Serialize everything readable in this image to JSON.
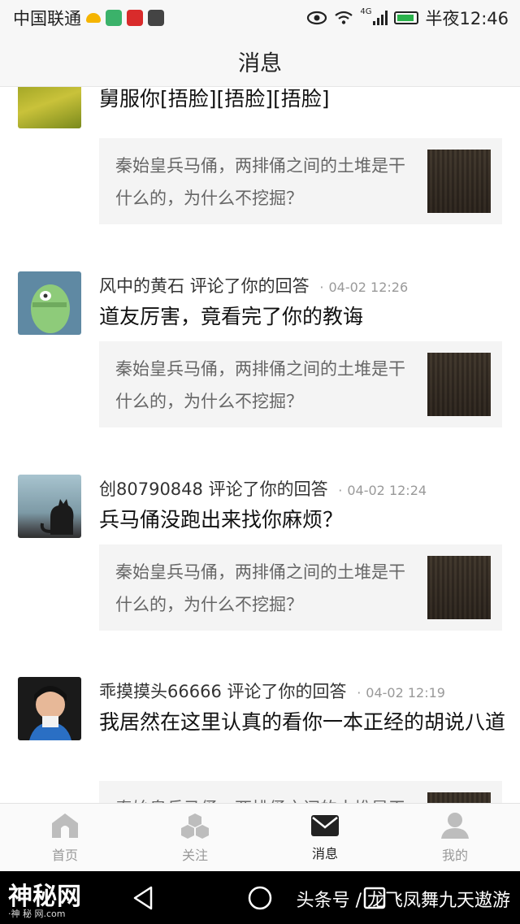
{
  "status_bar": {
    "carrier": "中国联通",
    "network": "4G",
    "time": "半夜12:46"
  },
  "header": {
    "title": "消息"
  },
  "feed": {
    "items": [
      {
        "user": "",
        "action": "",
        "time": "",
        "comment": "舅服你[捂脸][捂脸][捂脸]",
        "question": "秦始皇兵马俑，两排俑之间的土堆是干什么的，为什么不挖掘？"
      },
      {
        "user": "风中的黄石",
        "action": "评论了你的回答",
        "time": "04-02 12:26",
        "comment": "道友厉害，竟看完了你的教诲",
        "question": "秦始皇兵马俑，两排俑之间的土堆是干什么的，为什么不挖掘？"
      },
      {
        "user": "创80790848",
        "action": "评论了你的回答",
        "time": "04-02 12:24",
        "comment": "兵马俑没跑出来找你麻烦？",
        "question": "秦始皇兵马俑，两排俑之间的土堆是干什么的，为什么不挖掘？"
      },
      {
        "user": "乖摸摸头66666",
        "action": "评论了你的回答",
        "time": "04-02 12:19",
        "comment": "我居然在这里认真的看你一本正经的胡说八道",
        "question": "秦始皇兵马俑，两排俑之间的土堆是干什么的，为什么不挖掘？"
      }
    ]
  },
  "tabbar": {
    "tabs": [
      {
        "label": "首页",
        "icon": "home-icon"
      },
      {
        "label": "关注",
        "icon": "follow-icon"
      },
      {
        "label": "消息",
        "icon": "message-icon",
        "active": true
      },
      {
        "label": "我的",
        "icon": "profile-icon"
      }
    ]
  },
  "watermark": {
    "left_big": "神秘网",
    "left_small": "·神 秘 网.com",
    "right": "头条号 / 龙飞凤舞九天遨游"
  }
}
